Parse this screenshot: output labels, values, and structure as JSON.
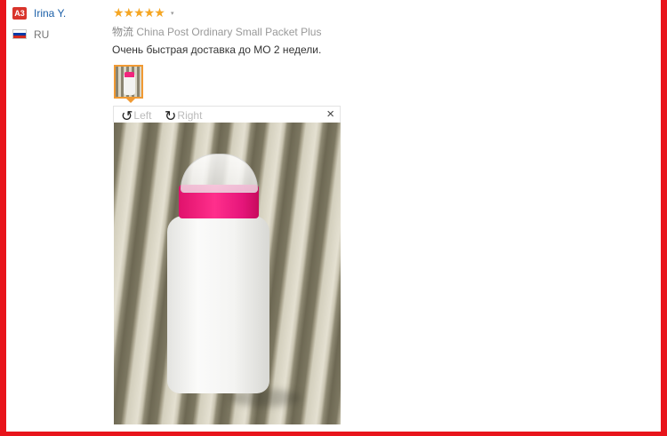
{
  "reviewer": {
    "badge": "A3",
    "name": "Irina Y.",
    "country": "RU",
    "flag_colors": [
      "#ffffff",
      "#0039a6",
      "#d52b1e"
    ]
  },
  "review": {
    "rating": 5,
    "rating_max": 5,
    "stars": "★★★★★",
    "shipping_label": "物流",
    "shipping_method": "China Post Ordinary Small Packet Plus",
    "text": "Очень быстрая доставка до МО 2 недели."
  },
  "viewer": {
    "rotate_left_label": "Left",
    "rotate_right_label": "Right",
    "rotate_left_icon": "rotate-left-icon",
    "rotate_right_icon": "rotate-right-icon",
    "close_icon": "close-icon",
    "close_glyph": "×"
  },
  "colors": {
    "frame": "#e8141b",
    "accent_orange": "#f09a34",
    "star": "#f5a623",
    "name_link": "#1a5fa8",
    "cap_pink": "#f2257d"
  }
}
